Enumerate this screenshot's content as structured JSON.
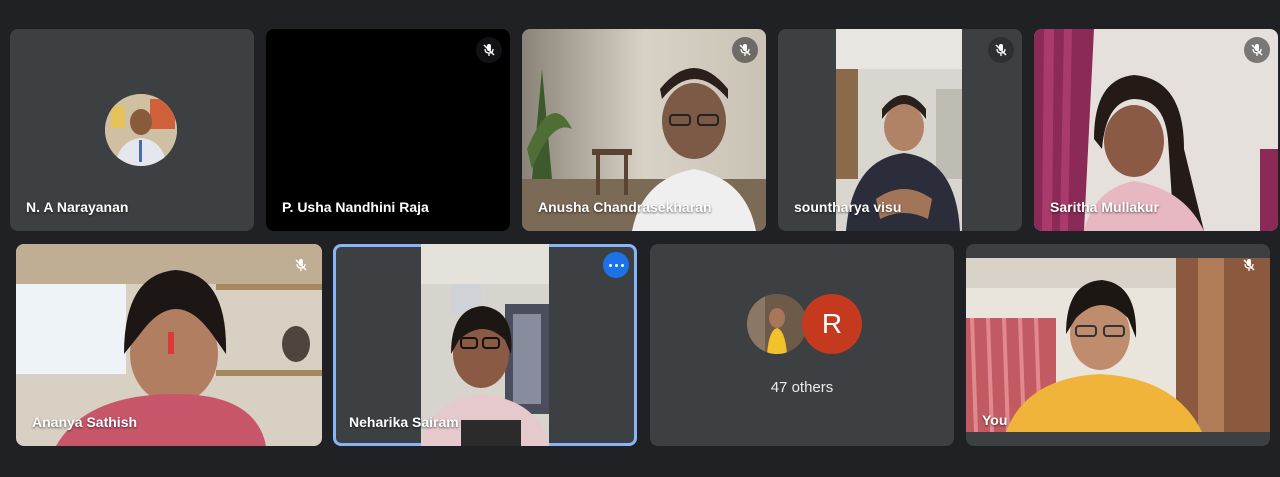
{
  "participants": [
    {
      "name": "N. A Narayanan"
    },
    {
      "name": "P. Usha Nandhini Raja"
    },
    {
      "name": "Anusha Chandrasekharan"
    },
    {
      "name": "sountharya visu"
    },
    {
      "name": "Saritha Mullakur"
    },
    {
      "name": "Ananya Sathish"
    },
    {
      "name": "Neharika Sairam"
    },
    {
      "name": "You"
    }
  ],
  "others": {
    "avatar_letter": "R",
    "label": "47 others"
  },
  "icons": {
    "muted": "mic-off-icon",
    "more": "more-options-icon"
  },
  "colors": {
    "background": "#202124",
    "tile": "#3c4043",
    "active_outline": "#8ab4f8",
    "accent": "#1a73e8",
    "avatar_r": "#c5391f"
  }
}
